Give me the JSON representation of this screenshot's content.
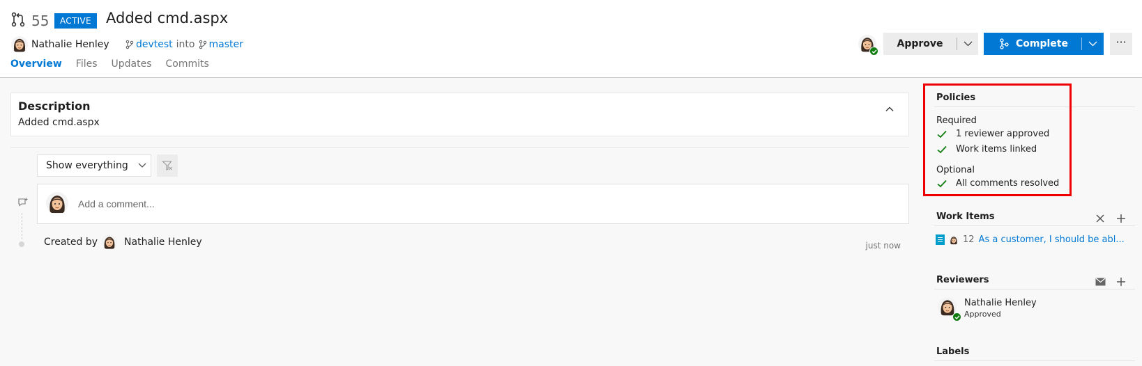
{
  "pull_request": {
    "id": "55",
    "status": "ACTIVE",
    "title": "Added cmd.aspx",
    "author": "Nathalie Henley",
    "source_branch": "devtest",
    "into_text": "into",
    "target_branch": "master"
  },
  "tabs": [
    {
      "label": "Overview",
      "active": true
    },
    {
      "label": "Files",
      "active": false
    },
    {
      "label": "Updates",
      "active": false
    },
    {
      "label": "Commits",
      "active": false
    }
  ],
  "actions": {
    "approve_label": "Approve",
    "complete_label": "Complete",
    "more_label": "···"
  },
  "description": {
    "heading": "Description",
    "text": "Added cmd.aspx"
  },
  "activity": {
    "filter_value": "Show everything",
    "comment_placeholder": "Add a comment...",
    "created_prefix": "Created by",
    "created_by": "Nathalie Henley",
    "created_time": "just now"
  },
  "policies": {
    "title": "Policies",
    "required_label": "Required",
    "required_items": [
      "1 reviewer approved",
      "Work items linked"
    ],
    "optional_label": "Optional",
    "optional_items": [
      "All comments resolved"
    ]
  },
  "work_items": {
    "title": "Work Items",
    "items": [
      {
        "id": "12",
        "title": "As a customer, I should be abl..."
      }
    ]
  },
  "reviewers": {
    "title": "Reviewers",
    "items": [
      {
        "name": "Nathalie Henley",
        "vote": "Approved"
      }
    ]
  },
  "labels": {
    "title": "Labels"
  },
  "colors": {
    "accent": "#0078d4",
    "approved": "#107c10",
    "highlight": "#ee0000"
  }
}
